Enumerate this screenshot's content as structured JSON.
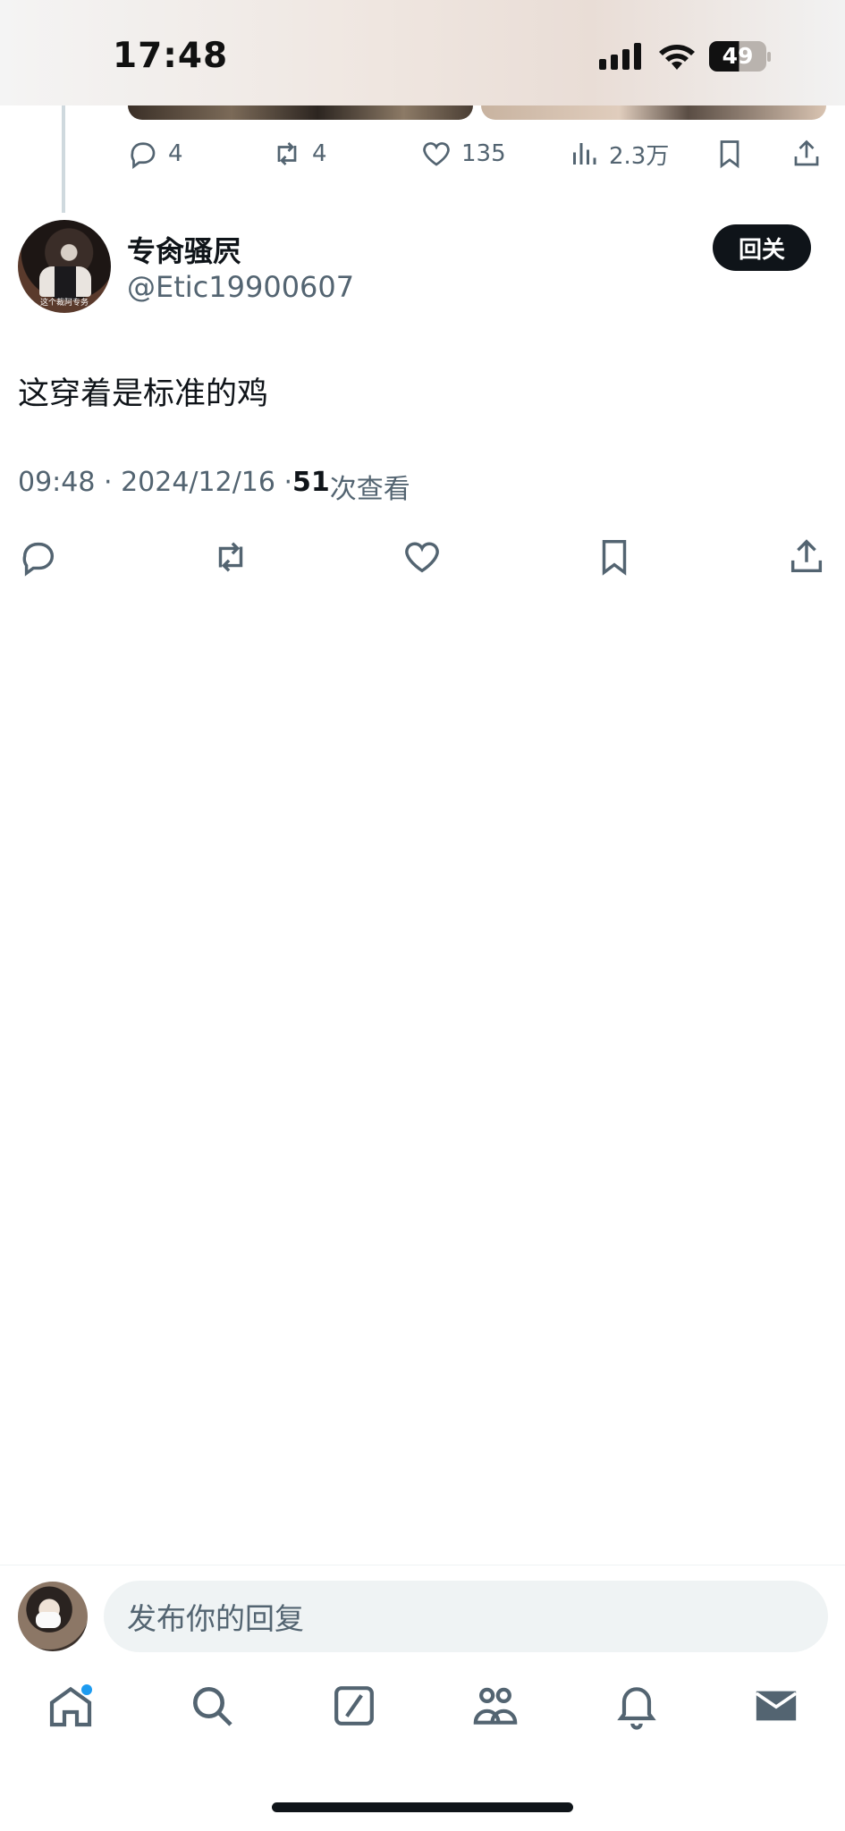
{
  "status_bar": {
    "time": "17:48",
    "battery": "49"
  },
  "previous_tweet": {
    "actions": {
      "replies": "4",
      "retweets": "4",
      "likes": "135",
      "views": "2.3万"
    }
  },
  "tweet": {
    "author_name": "专肏骚屄",
    "author_handle": "@Etic19900607",
    "follow_button_label": "回关",
    "avatar_caption": "这个裁阿专务",
    "text": "这穿着是标准的鸡",
    "timestamp": "09:48 · 2024/12/16 · ",
    "view_count": "51",
    "view_label": " 次查看"
  },
  "reply_composer": {
    "placeholder": "发布你的回复"
  },
  "bottom_nav": {
    "items": [
      "home-icon",
      "search-icon",
      "grok-icon",
      "communities-icon",
      "notifications-icon",
      "messages-icon"
    ],
    "home_has_notification": true
  },
  "colors": {
    "text_primary": "#0f1419",
    "text_secondary": "#536471",
    "accent": "#1d9bf0",
    "input_bg": "#eff3f4"
  }
}
